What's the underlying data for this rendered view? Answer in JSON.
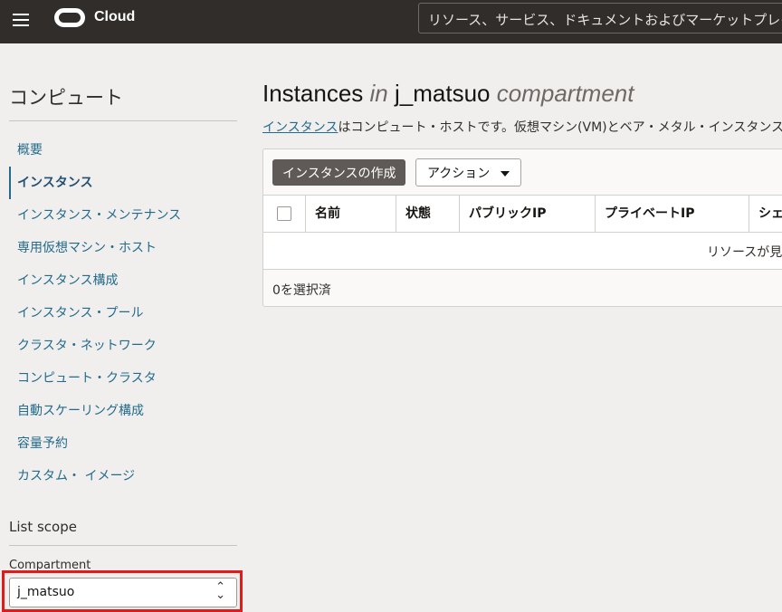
{
  "header": {
    "menu_icon": "hamburger-menu-icon",
    "brand": "Cloud",
    "search_placeholder": "リソース、サービス、ドキュメントおよびマーケットプレイス"
  },
  "sidebar": {
    "title": "コンピュート",
    "items": [
      {
        "label": "概要",
        "active": false
      },
      {
        "label": "インスタンス",
        "active": true
      },
      {
        "label": "インスタンス・メンテナンス",
        "active": false
      },
      {
        "label": "専用仮想マシン・ホスト",
        "active": false
      },
      {
        "label": "インスタンス構成",
        "active": false
      },
      {
        "label": "インスタンス・プール",
        "active": false
      },
      {
        "label": "クラスタ・ネットワーク",
        "active": false
      },
      {
        "label": "コンピュート・クラスタ",
        "active": false
      },
      {
        "label": "自動スケーリング構成",
        "active": false
      },
      {
        "label": "容量予約",
        "active": false
      },
      {
        "label": "カスタム・ イメージ",
        "active": false
      }
    ],
    "scope_title": "List scope",
    "compartment_label": "Compartment",
    "compartment_value": "j_matsuo"
  },
  "main": {
    "title_word": "Instances",
    "title_in": "in",
    "title_compartment": "j_matsuo",
    "title_suffix": "compartment",
    "subtitle_link": "インスタンス",
    "subtitle_text": "はコンピュート・ホストです。仮想マシン(VM)とベア・メタル・インスタンス",
    "create_button": "インスタンスの作成",
    "actions_button": "アクション",
    "columns": [
      "名前",
      "状態",
      "パブリックIP",
      "プライベートIP",
      "シェ"
    ],
    "empty_text": "リソースが見",
    "selected_count": "0を選択済"
  }
}
